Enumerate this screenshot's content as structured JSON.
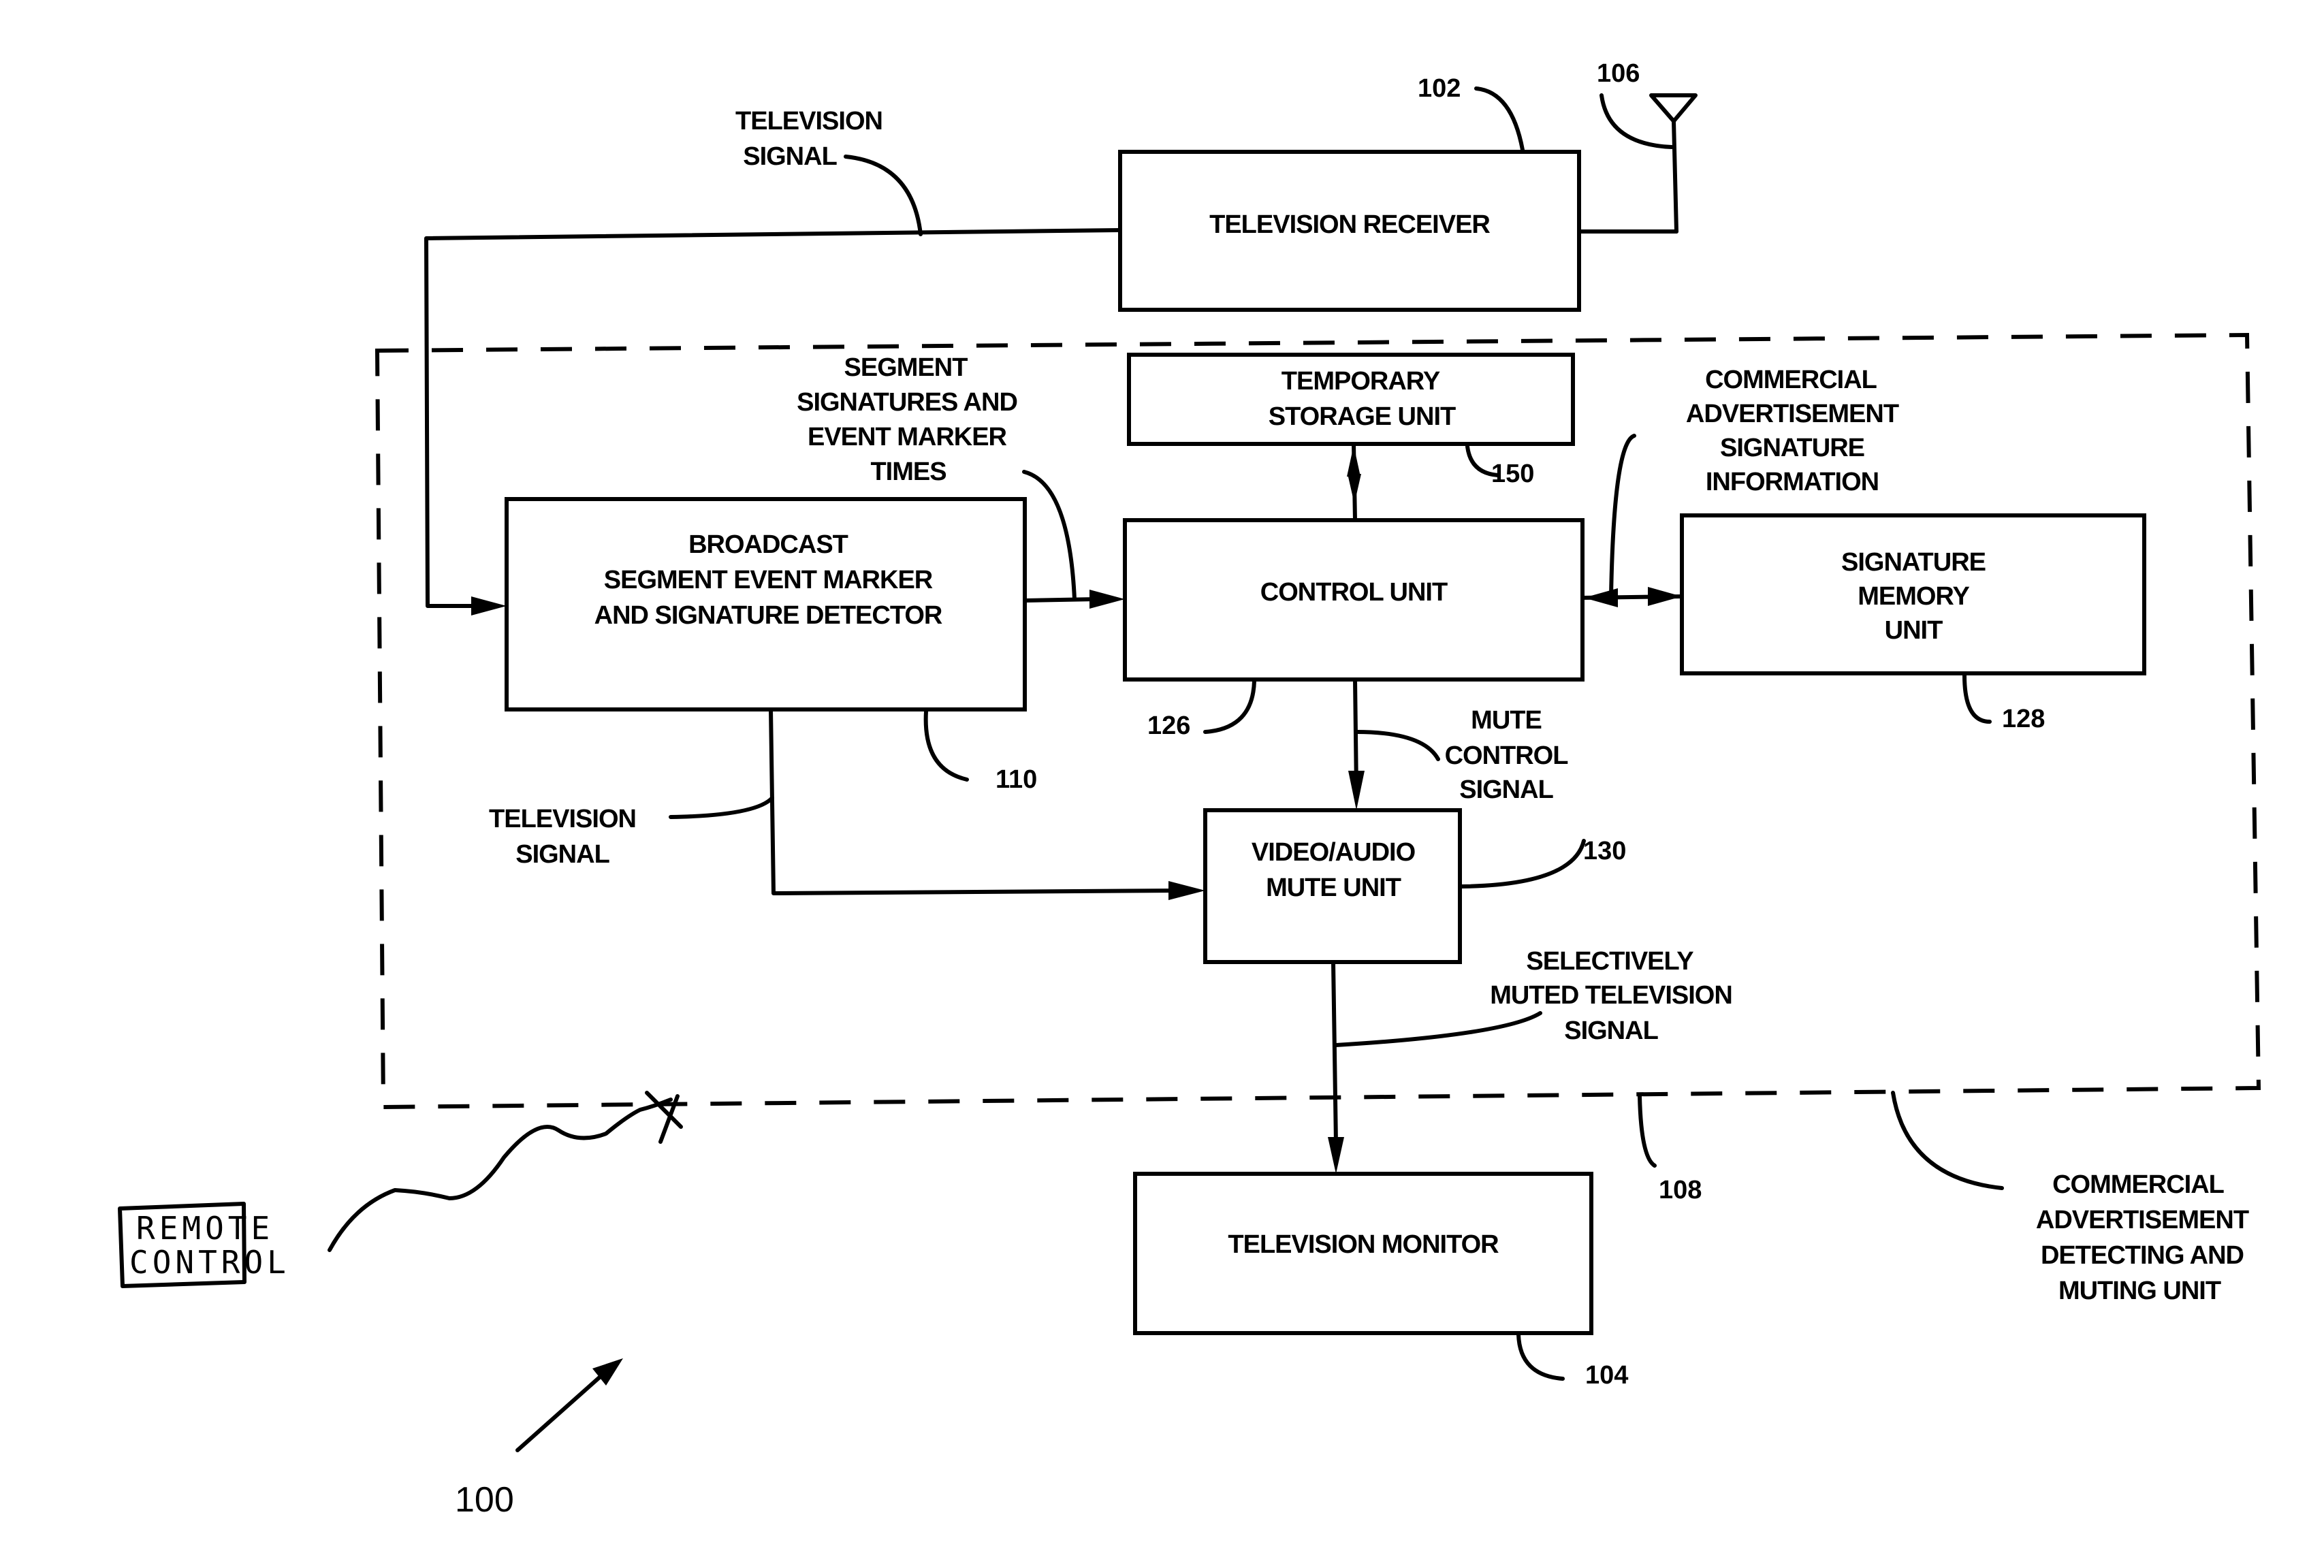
{
  "figure": {
    "reference_number": "100",
    "description": "Block diagram of commercial advertisement detecting and muting system"
  },
  "blocks": {
    "tv_receiver": {
      "lines": [
        "TELEVISION RECEIVER"
      ],
      "ref": "102"
    },
    "antenna": {
      "ref": "106"
    },
    "temp_storage": {
      "lines": [
        "TEMPORARY",
        "STORAGE UNIT"
      ],
      "ref": "150"
    },
    "control_unit": {
      "lines": [
        "CONTROL UNIT"
      ],
      "ref": "126"
    },
    "detector": {
      "lines": [
        "BROADCAST",
        "SEGMENT EVENT MARKER",
        "AND SIGNATURE DETECTOR"
      ],
      "ref": "110"
    },
    "signature_memory": {
      "lines": [
        "SIGNATURE",
        "MEMORY",
        "UNIT"
      ],
      "ref": "128"
    },
    "mute_unit": {
      "lines": [
        "VIDEO/AUDIO",
        "MUTE UNIT"
      ],
      "ref": "130"
    },
    "tv_monitor": {
      "lines": [
        "TELEVISION MONITOR"
      ],
      "ref": "104"
    },
    "detecting_muting_unit": {
      "lines": [
        "COMMERCIAL",
        "ADVERTISEMENT",
        "DETECTING AND",
        "MUTING UNIT"
      ],
      "ref": "108"
    },
    "remote_control": {
      "lines": [
        "REMOTE",
        "CONTROL"
      ]
    }
  },
  "signal_labels": {
    "tv_signal_top": [
      "TELEVISION",
      "SIGNAL"
    ],
    "segment_signatures": [
      "SEGMENT",
      "SIGNATURES AND",
      "EVENT MARKER",
      "TIMES"
    ],
    "ad_signature_info": [
      "COMMERCIAL",
      "ADVERTISEMENT",
      "SIGNATURE",
      "INFORMATION"
    ],
    "mute_control": [
      "MUTE",
      "CONTROL",
      "SIGNAL"
    ],
    "tv_signal_lower": [
      "TELEVISION",
      "SIGNAL"
    ],
    "selectively_muted": [
      "SELECTIVELY",
      "MUTED TELEVISION",
      "SIGNAL"
    ]
  }
}
